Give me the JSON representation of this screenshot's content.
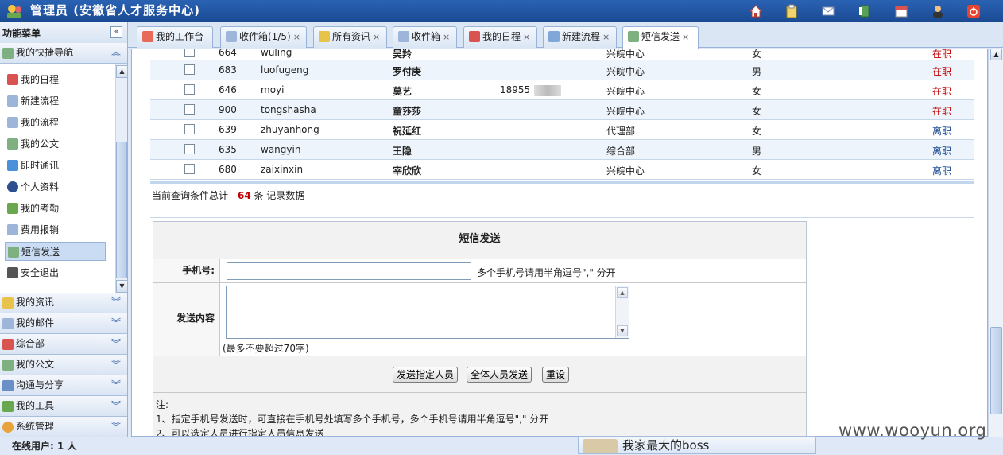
{
  "header": {
    "title": "管理员 (安徽省人才服务中心)",
    "icons": [
      "home-icon",
      "clipboard-icon",
      "mail-icon",
      "book-icon",
      "calendar-icon",
      "user-icon",
      "power-icon"
    ]
  },
  "sidebar": {
    "title": "功能菜单",
    "collapse_glyph": "«",
    "quick_nav": "我的快捷导航",
    "items": [
      {
        "label": "我的日程",
        "icon": "calendar-icon"
      },
      {
        "label": "新建流程",
        "icon": "doc-new-icon"
      },
      {
        "label": "我的流程",
        "icon": "doc-flow-icon"
      },
      {
        "label": "我的公文",
        "icon": "doc-official-icon"
      },
      {
        "label": "即时通讯",
        "icon": "chat-icon"
      },
      {
        "label": "个人资料",
        "icon": "person-icon"
      },
      {
        "label": "我的考勤",
        "icon": "attendance-icon"
      },
      {
        "label": "费用报销",
        "icon": "expense-icon"
      },
      {
        "label": "短信发送",
        "icon": "sms-icon",
        "selected": true
      },
      {
        "label": "安全退出",
        "icon": "logout-icon"
      }
    ],
    "groups": [
      {
        "label": "我的资讯",
        "icon": "info-icon"
      },
      {
        "label": "我的邮件",
        "icon": "mail-icon"
      },
      {
        "label": "综合部",
        "icon": "calendar-icon"
      },
      {
        "label": "我的公文",
        "icon": "doc-official-icon"
      },
      {
        "label": "沟通与分享",
        "icon": "share-icon"
      },
      {
        "label": "我的工具",
        "icon": "tools-icon"
      },
      {
        "label": "系统管理",
        "icon": "settings-icon"
      }
    ]
  },
  "tabs": [
    {
      "label": "我的工作台",
      "icon": "home-icon"
    },
    {
      "label": "收件箱(1/5)",
      "icon": "inbox-icon"
    },
    {
      "label": "所有资讯",
      "icon": "clipboard-icon"
    },
    {
      "label": "收件箱",
      "icon": "inbox-icon"
    },
    {
      "label": "我的日程",
      "icon": "calendar-icon"
    },
    {
      "label": "新建流程",
      "icon": "doc-new-icon"
    },
    {
      "label": "短信发送",
      "icon": "sms-icon",
      "active": true
    }
  ],
  "tab_close": "×",
  "table": {
    "rows": [
      {
        "id": "664",
        "user": "wuling",
        "name": "吴羚",
        "phone": "",
        "dept": "兴皖中心",
        "gender": "女",
        "status": "在职"
      },
      {
        "id": "683",
        "user": "luofugeng",
        "name": "罗付庚",
        "phone": "",
        "dept": "兴皖中心",
        "gender": "男",
        "status": "在职"
      },
      {
        "id": "646",
        "user": "moyi",
        "name": "莫艺",
        "phone": "18955",
        "dept": "兴皖中心",
        "gender": "女",
        "status": "在职"
      },
      {
        "id": "900",
        "user": "tongshasha",
        "name": "童莎莎",
        "phone": "",
        "dept": "兴皖中心",
        "gender": "女",
        "status": "在职"
      },
      {
        "id": "639",
        "user": "zhuyanhong",
        "name": "祝延红",
        "phone": "",
        "dept": "代理部",
        "gender": "女",
        "status": "离职"
      },
      {
        "id": "635",
        "user": "wangyin",
        "name": "王隐",
        "phone": "",
        "dept": "综合部",
        "gender": "男",
        "status": "离职"
      },
      {
        "id": "680",
        "user": "zaixinxin",
        "name": "宰欣欣",
        "phone": "",
        "dept": "兴皖中心",
        "gender": "女",
        "status": "离职"
      }
    ],
    "status_colors": {
      "在职": "#c00000",
      "离职": "#1b4a93"
    }
  },
  "summary": {
    "prefix": "当前查询条件总计 - ",
    "count": "64",
    "suffix": " 条 记录数据"
  },
  "sms": {
    "title": "短信发送",
    "phone_label": "手机号:",
    "phone_value": "",
    "phone_hint": "多个手机号请用半角逗号\",\" 分开",
    "content_label": "发送内容",
    "content_value": "",
    "limit": "(最多不要超过70字)",
    "buttons": {
      "send_selected": "发送指定人员",
      "send_all": "全体人员发送",
      "reset": "重设"
    },
    "notes": [
      "注:",
      "1、指定手机号发送时，可直接在手机号处填写多个手机号，多个手机号请用半角逗号\",\" 分开",
      "2、可以选定人员进行指定人员信息发送"
    ]
  },
  "status_bar": "在线用户: 1 人",
  "im_popup": "我家最大的boss",
  "watermark": "www.wooyun.org"
}
